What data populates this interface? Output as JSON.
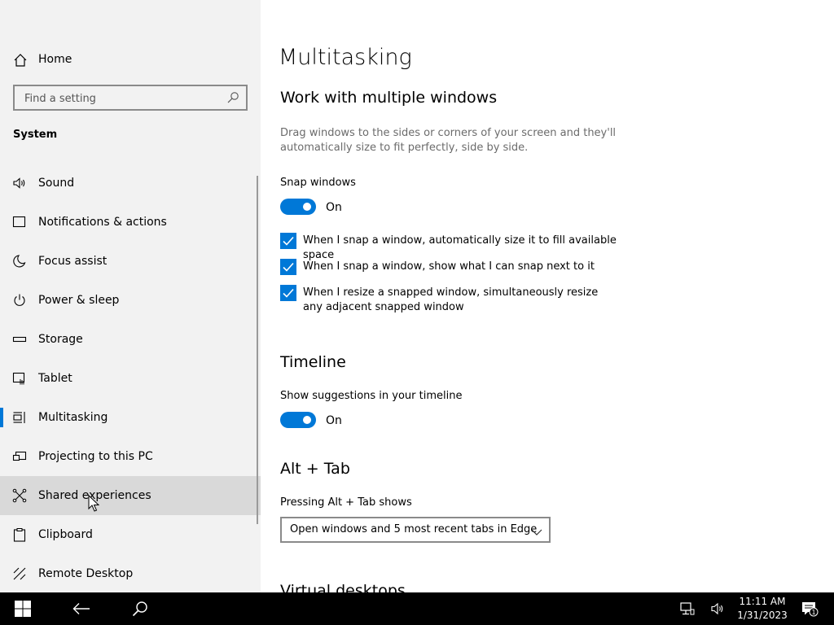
{
  "sidebar": {
    "home_label": "Home",
    "search_placeholder": "Find a setting",
    "section_title": "System",
    "items": [
      {
        "label": "Sound",
        "icon": "speaker-icon"
      },
      {
        "label": "Notifications & actions",
        "icon": "notification-icon"
      },
      {
        "label": "Focus assist",
        "icon": "moon-icon"
      },
      {
        "label": "Power & sleep",
        "icon": "power-icon"
      },
      {
        "label": "Storage",
        "icon": "storage-icon"
      },
      {
        "label": "Tablet",
        "icon": "tablet-icon"
      },
      {
        "label": "Multitasking",
        "icon": "multitasking-icon",
        "selected": true
      },
      {
        "label": "Projecting to this PC",
        "icon": "projector-icon"
      },
      {
        "label": "Shared experiences",
        "icon": "shared-experiences-icon",
        "hovered": true
      },
      {
        "label": "Clipboard",
        "icon": "clipboard-icon"
      },
      {
        "label": "Remote Desktop",
        "icon": "remote-desktop-icon"
      }
    ]
  },
  "main": {
    "page_title": "Multitasking",
    "windows_section": {
      "title": "Work with multiple windows",
      "description": "Drag windows to the sides or corners of your screen and they'll automatically size to fit perfectly, side by side.",
      "snap_label": "Snap windows",
      "snap_state": "On",
      "checkboxes": [
        {
          "label": "When I snap a window, automatically size it to fill available space",
          "checked": true
        },
        {
          "label": "When I snap a window, show what I can snap next to it",
          "checked": true
        },
        {
          "label": "When I resize a snapped window, simultaneously resize any adjacent snapped window",
          "checked": true
        }
      ]
    },
    "timeline_section": {
      "title": "Timeline",
      "suggestions_label": "Show suggestions in your timeline",
      "suggestions_state": "On"
    },
    "alttab_section": {
      "title": "Alt + Tab",
      "label": "Pressing Alt + Tab shows",
      "selected_value": "Open windows and 5 most recent tabs in Edge"
    },
    "next_section_title": "Virtual desktops"
  },
  "taskbar": {
    "time": "11:11 AM",
    "date": "1/31/2023",
    "notification_count": "1"
  },
  "colors": {
    "accent": "#0078d7",
    "sidebar_bg": "#f2f2f2",
    "hover_bg": "#d9d9d9",
    "taskbar_bg": "#000000"
  }
}
